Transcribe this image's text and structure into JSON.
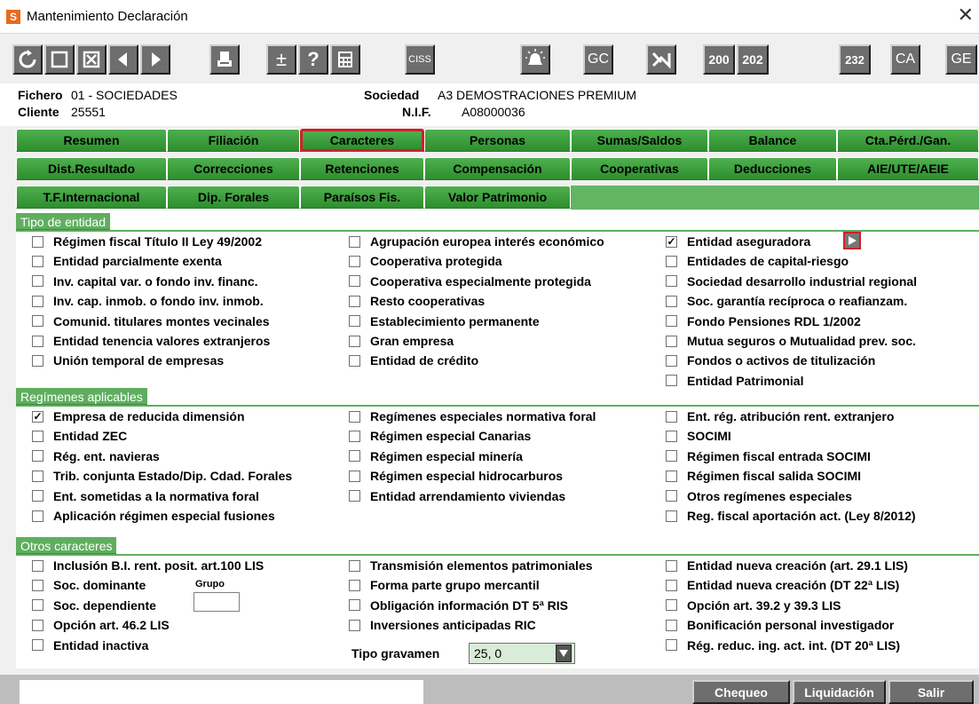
{
  "window": {
    "title": "Mantenimiento Declaración",
    "app_icon_letter": "S"
  },
  "toolbar": {
    "buttons": [
      {
        "name": "refresh",
        "label": ""
      },
      {
        "name": "new",
        "label": ""
      },
      {
        "name": "delete",
        "label": ""
      },
      {
        "name": "prev",
        "label": ""
      },
      {
        "name": "next",
        "label": ""
      },
      {
        "name": "print",
        "label": ""
      },
      {
        "name": "plusminus",
        "label": "±"
      },
      {
        "name": "help",
        "label": "?"
      },
      {
        "name": "calculator",
        "label": ""
      },
      {
        "name": "ciss",
        "label": "CISS"
      },
      {
        "name": "alarm",
        "label": ""
      },
      {
        "name": "gc",
        "label": "GC"
      },
      {
        "name": "tools",
        "label": ""
      },
      {
        "name": "m200",
        "label": "200"
      },
      {
        "name": "m202",
        "label": "202"
      },
      {
        "name": "m232",
        "label": "232"
      },
      {
        "name": "ca",
        "label": "CA"
      },
      {
        "name": "ge",
        "label": "GE"
      }
    ]
  },
  "info": {
    "fichero_label": "Fichero",
    "fichero_value": "01 - SOCIEDADES",
    "cliente_label": "Cliente",
    "cliente_value": "25551",
    "sociedad_label": "Sociedad",
    "sociedad_value": "A3 DEMOSTRACIONES PREMIUM",
    "nif_label": "N.I.F.",
    "nif_value": "A08000036"
  },
  "tabs": {
    "row1": [
      "Resumen",
      "Filiación",
      "Caracteres",
      "Personas",
      "Sumas/Saldos",
      "Balance",
      "Cta.Pérd./Gan."
    ],
    "row2": [
      "Dist.Resultado",
      "Correcciones",
      "Retenciones",
      "Compensación",
      "Cooperativas",
      "Deducciones",
      "AIE/UTE/AEIE"
    ],
    "row3": [
      "T.F.Internacional",
      "Dip. Forales",
      "Paraísos Fis.",
      "Valor Patrimonio"
    ],
    "selected": "Caracteres"
  },
  "sections": {
    "tipo": {
      "title": "Tipo de entidad",
      "col1": [
        {
          "label": "Régimen fiscal Título II Ley 49/2002",
          "checked": false
        },
        {
          "label": "Entidad parcialmente exenta",
          "checked": false
        },
        {
          "label": "Inv. capital var. o fondo inv. financ.",
          "checked": false
        },
        {
          "label": "Inv. cap. inmob. o fondo inv. inmob.",
          "checked": false
        },
        {
          "label": "Comunid. titulares montes vecinales",
          "checked": false
        },
        {
          "label": "Entidad tenencia valores extranjeros",
          "checked": false
        },
        {
          "label": "Unión temporal de empresas",
          "checked": false
        }
      ],
      "col2": [
        {
          "label": "Agrupación europea interés económico",
          "checked": false
        },
        {
          "label": "Cooperativa protegida",
          "checked": false
        },
        {
          "label": "Cooperativa especialmente protegida",
          "checked": false
        },
        {
          "label": "Resto cooperativas",
          "checked": false
        },
        {
          "label": "Establecimiento permanente",
          "checked": false
        },
        {
          "label": "Gran empresa",
          "checked": false
        },
        {
          "label": "Entidad de crédito",
          "checked": false
        }
      ],
      "col3": [
        {
          "label": "Entidad aseguradora",
          "checked": true
        },
        {
          "label": "Entidades de capital-riesgo",
          "checked": false
        },
        {
          "label": "Sociedad desarrollo industrial regional",
          "checked": false
        },
        {
          "label": "Soc. garantía recíproca o reafianzam.",
          "checked": false
        },
        {
          "label": "Fondo Pensiones RDL 1/2002",
          "checked": false
        },
        {
          "label": "Mutua seguros o Mutualidad prev. soc.",
          "checked": false
        },
        {
          "label": "Fondos o activos de titulización",
          "checked": false
        },
        {
          "label": "Entidad Patrimonial",
          "checked": false
        }
      ]
    },
    "regimenes": {
      "title": "Regímenes aplicables",
      "col1": [
        {
          "label": "Empresa de reducida dimensión",
          "checked": true
        },
        {
          "label": "Entidad ZEC",
          "checked": false
        },
        {
          "label": "Rég. ent. navieras",
          "checked": false
        },
        {
          "label": "Trib. conjunta Estado/Dip. Cdad. Forales",
          "checked": false
        },
        {
          "label": "Ent. sometidas a la normativa foral",
          "checked": false
        },
        {
          "label": "Aplicación régimen especial fusiones",
          "checked": false
        }
      ],
      "col2": [
        {
          "label": "Regímenes especiales normativa foral",
          "checked": false
        },
        {
          "label": "Régimen especial Canarias",
          "checked": false
        },
        {
          "label": "Régimen especial minería",
          "checked": false
        },
        {
          "label": "Régimen especial hidrocarburos",
          "checked": false
        },
        {
          "label": "Entidad arrendamiento viviendas",
          "checked": false
        }
      ],
      "col3": [
        {
          "label": "Ent. rég. atribución rent. extranjero",
          "checked": false
        },
        {
          "label": "SOCIMI",
          "checked": false
        },
        {
          "label": "Régimen fiscal entrada SOCIMI",
          "checked": false
        },
        {
          "label": "Régimen fiscal salida SOCIMI",
          "checked": false
        },
        {
          "label": "Otros regímenes especiales",
          "checked": false
        },
        {
          "label": "Reg. fiscal aportación act. (Ley 8/2012)",
          "checked": false
        }
      ]
    },
    "otros": {
      "title": "Otros caracteres",
      "col1": [
        {
          "label": "Inclusión B.I. rent. posit. art.100 LIS",
          "checked": false
        },
        {
          "label": "Soc. dominante",
          "checked": false
        },
        {
          "label": "Soc. dependiente",
          "checked": false
        },
        {
          "label": "Opción art. 46.2 LIS",
          "checked": false
        },
        {
          "label": "Entidad inactiva",
          "checked": false
        }
      ],
      "col2": [
        {
          "label": "Transmisión elementos patrimoniales",
          "checked": false
        },
        {
          "label": "Forma parte grupo mercantil",
          "checked": false
        },
        {
          "label": "Obligación información DT 5ª RIS",
          "checked": false
        },
        {
          "label": "Inversiones anticipadas RIC",
          "checked": false
        }
      ],
      "col3": [
        {
          "label": "Entidad nueva creación (art. 29.1 LIS)",
          "checked": false
        },
        {
          "label": "Entidad nueva creación  (DT 22ª LIS)",
          "checked": false
        },
        {
          "label": "Opción art. 39.2 y 39.3 LIS",
          "checked": false
        },
        {
          "label": "Bonificación personal investigador",
          "checked": false
        },
        {
          "label": "Rég. reduc. ing. act. int. (DT 20ª LIS)",
          "checked": false
        }
      ],
      "grupo_label": "Grupo",
      "grupo_value": "",
      "tipo_gravamen_label": "Tipo gravamen",
      "tipo_gravamen_value": "25, 0"
    }
  },
  "statusbar": {
    "status_text": "",
    "chequeo": "Chequeo",
    "liquidacion": "Liquidación",
    "salir": "Salir"
  }
}
